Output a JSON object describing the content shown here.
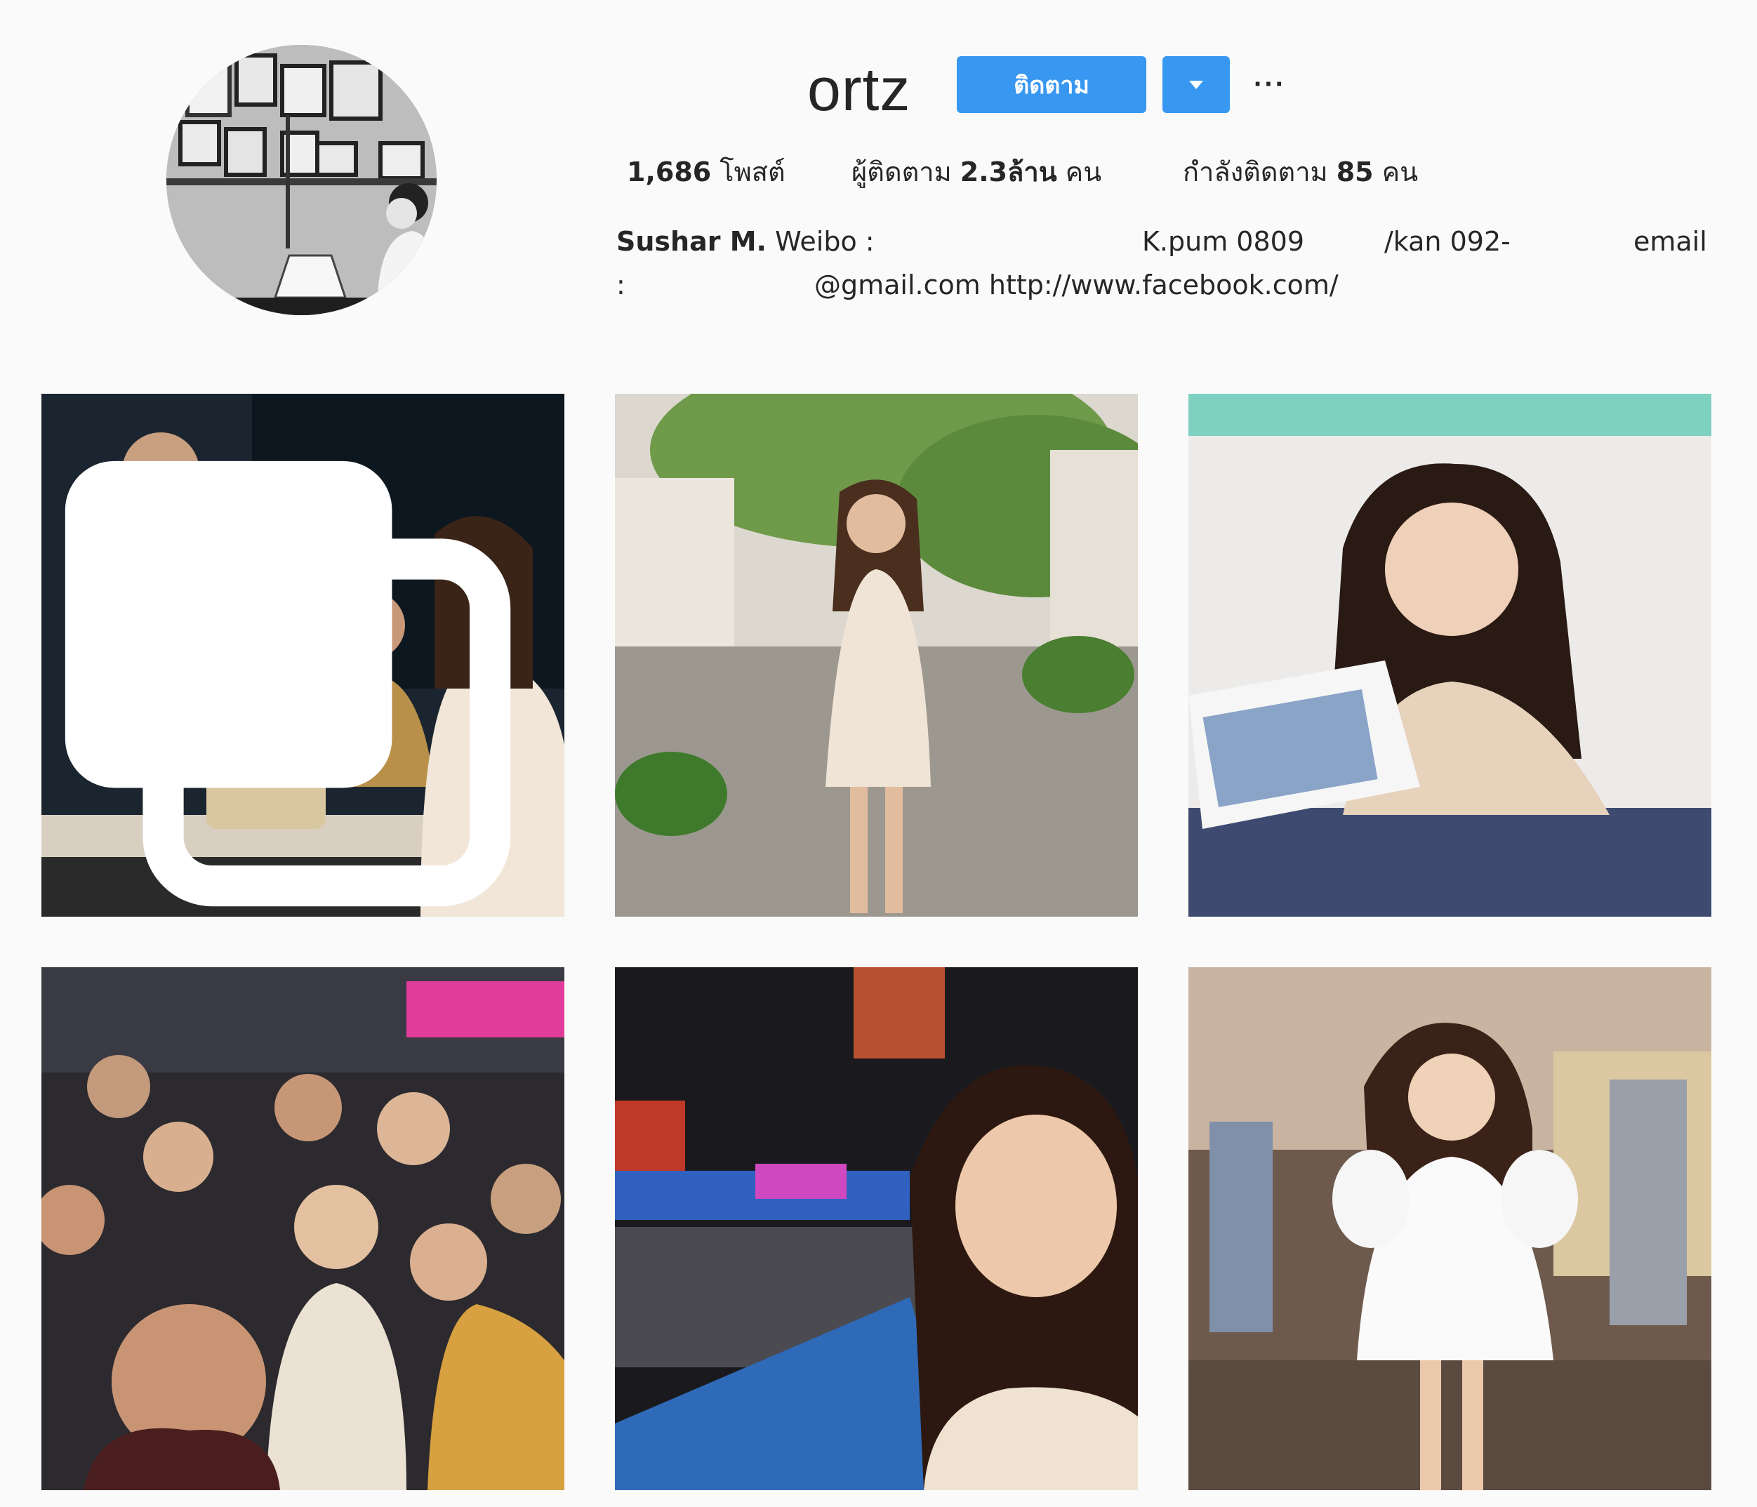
{
  "profile": {
    "username": "ortz",
    "follow_label": "ติดตาม",
    "dropdown_icon": "caret-down-icon",
    "more_label": "···",
    "stats": {
      "posts_count": "1,686",
      "posts_label": "โพสต์",
      "followers_label": "ผู้ติดตาม",
      "followers_count": "2.3ล้าน",
      "followers_unit": "คน",
      "following_label": "กำลังติดตาม",
      "following_count": "85",
      "following_unit": "คน"
    },
    "bio": {
      "name": "Sushar M.",
      "weibo": "Weibo :",
      "kpum": "K.pum 0809",
      "kan": "/kan 092-",
      "email_label": "email",
      "colon": ":",
      "links": "@gmail.com http://www.facebook.com/"
    }
  },
  "posts": [
    {
      "id": "post-1",
      "multi": true
    },
    {
      "id": "post-2",
      "multi": false
    },
    {
      "id": "post-3",
      "multi": false
    },
    {
      "id": "post-4",
      "multi": false
    },
    {
      "id": "post-5",
      "multi": false
    },
    {
      "id": "post-6",
      "multi": false
    }
  ],
  "colors": {
    "accent": "#3897f0",
    "background": "#fafafa",
    "text": "#262626"
  }
}
